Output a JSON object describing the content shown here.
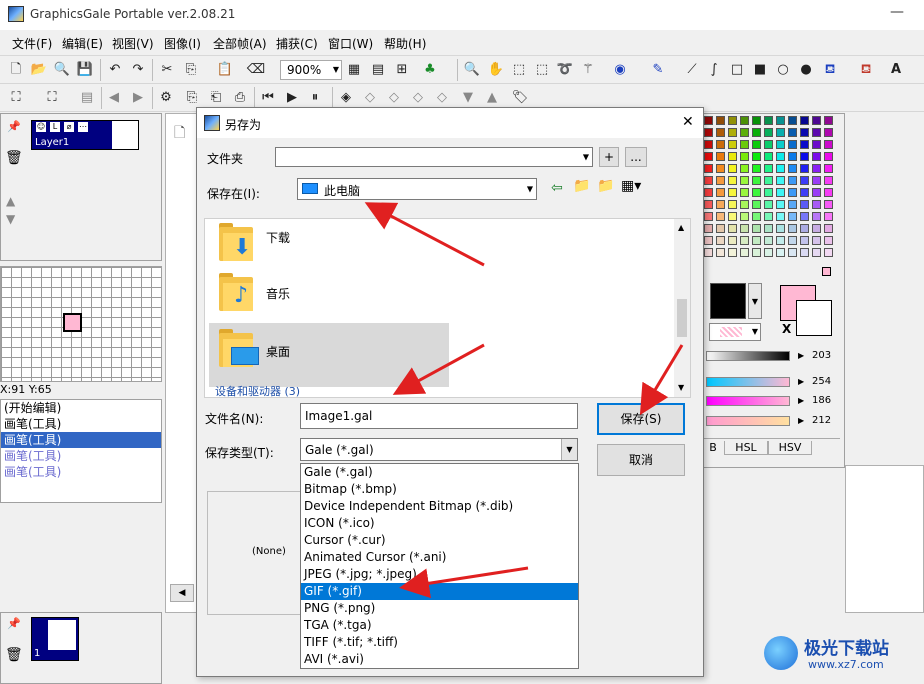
{
  "app": {
    "title": "GraphicsGale Portable ver.2.08.21",
    "minimize": "—"
  },
  "menu": [
    "文件(F)",
    "编辑(E)",
    "视图(V)",
    "图像(I)",
    "全部帧(A)",
    "捕获(C)",
    "窗口(W)",
    "帮助(H)"
  ],
  "toolbar": {
    "zoom": "900%"
  },
  "layers": {
    "layer_name": "Layer1",
    "frame_label": "1"
  },
  "status": {
    "coords": "X:91 Y:65"
  },
  "history": [
    "(开始编辑)",
    "画笔(工具)",
    "画笔(工具)",
    "画笔(工具)",
    "画笔(工具)"
  ],
  "dialog": {
    "title": "另存为",
    "close": "✕",
    "folder_label": "文件夹",
    "folder_plus": "+",
    "folder_more": "...",
    "save_in_label": "保存在(I):",
    "save_in_value": "此电脑",
    "items": [
      {
        "label": "下载",
        "icon": "download-folder-icon"
      },
      {
        "label": "音乐",
        "icon": "music-folder-icon"
      },
      {
        "label": "桌面",
        "icon": "desktop-folder-icon"
      }
    ],
    "group_header": "设备和驱动器 (3)",
    "filename_label": "文件名(N):",
    "filename_value": "Image1.gal",
    "filetype_label": "保存类型(T):",
    "filetype_value": "Gale (*.gal)",
    "save_button": "保存(S)",
    "cancel_button": "取消",
    "preview_none": "(None)",
    "filetype_options": [
      "Gale (*.gal)",
      "Bitmap (*.bmp)",
      "Device Independent Bitmap (*.dib)",
      "ICON (*.ico)",
      "Cursor (*.cur)",
      "Animated Cursor (*.ani)",
      "JPEG (*.jpg; *.jpeg)",
      "GIF (*.gif)",
      "PNG (*.png)",
      "TGA (*.tga)",
      "TIFF (*.tif; *.tiff)",
      "AVI (*.avi)"
    ],
    "selected_option": "GIF (*.gif)"
  },
  "color_panel": {
    "values": [
      "203",
      "254",
      "186",
      "212"
    ],
    "tabs": [
      "B",
      "HSL",
      "HSV"
    ],
    "swap_label": "X",
    "fg_color": "#000000",
    "bg_color": "#ffb8d3"
  },
  "watermark": {
    "name": "极光下载站",
    "url": "www.xz7.com"
  }
}
